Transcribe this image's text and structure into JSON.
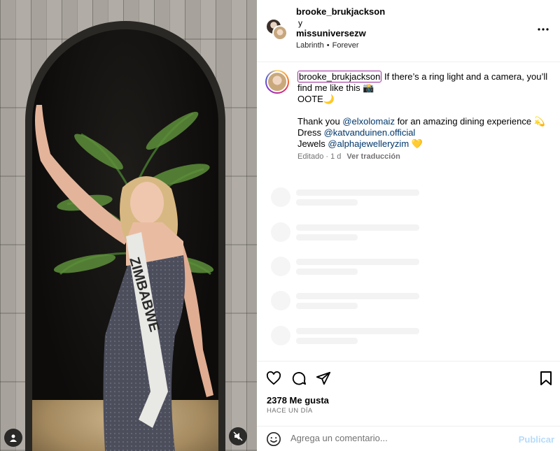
{
  "media": {
    "sash_text": "ZIMBABWE",
    "user_icon": "user-icon",
    "mute_icon": "muted-speaker-icon"
  },
  "header": {
    "user1": "brooke_brukjackson",
    "conjunction": "y",
    "user2": "missuniversezw",
    "music_artist": "Labrinth",
    "music_separator": "•",
    "music_track": "Forever",
    "more_icon": "more-options-icon"
  },
  "caption": {
    "username": "brooke_brukjackson",
    "line1": " If there’s a ring light and a camera, you’ll find me like this 📸",
    "line2": "OOTE🌙",
    "thanks_prefix": "Thank you ",
    "thanks_handle": "@elxolomaiz",
    "thanks_suffix": " for an amazing dining experience 💫",
    "dress_label": "Dress ",
    "dress_handle": "@katvanduinen.official",
    "jewels_label": "Jewels ",
    "jewels_handle": "@alphajewelleryzim",
    "jewels_emoji": " 💛",
    "edited": "Editado · 1 d",
    "translate": "Ver traducción"
  },
  "actions": {
    "like_icon": "heart-icon",
    "comment_icon": "comment-icon",
    "share_icon": "send-icon",
    "save_icon": "bookmark-icon"
  },
  "stats": {
    "likes": "2378 Me gusta",
    "time": "HACE UN DÍA"
  },
  "comment": {
    "emoji_icon": "emoji-icon",
    "placeholder": "Agrega un comentario...",
    "publish": "Publicar"
  },
  "colors": {
    "link": "#00376b",
    "muted": "#737373",
    "publish_disabled": "#b6dcfb"
  }
}
